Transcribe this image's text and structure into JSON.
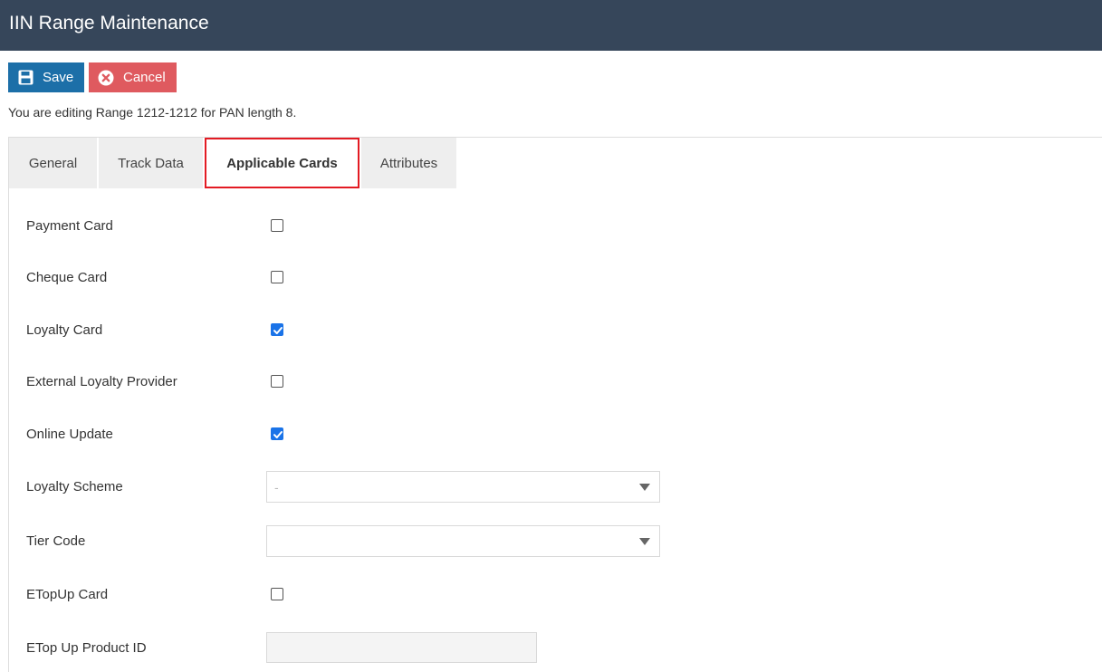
{
  "header": {
    "title": "IIN Range Maintenance"
  },
  "toolbar": {
    "save_label": "Save",
    "cancel_label": "Cancel",
    "save_icon": "floppy-disk-icon",
    "cancel_icon": "close-circle-icon"
  },
  "editing_message": "You are editing Range 1212-1212 for PAN length 8.",
  "tabs": [
    {
      "label": "General",
      "active": false
    },
    {
      "label": "Track Data",
      "active": false
    },
    {
      "label": "Applicable Cards",
      "active": true
    },
    {
      "label": "Attributes",
      "active": false
    }
  ],
  "form": {
    "payment_card": {
      "label": "Payment Card",
      "checked": false
    },
    "cheque_card": {
      "label": "Cheque Card",
      "checked": false
    },
    "loyalty_card": {
      "label": "Loyalty Card",
      "checked": true
    },
    "external_loyalty_provider": {
      "label": "External Loyalty Provider",
      "checked": false
    },
    "online_update": {
      "label": "Online Update",
      "checked": true
    },
    "loyalty_scheme": {
      "label": "Loyalty Scheme",
      "value": "-"
    },
    "tier_code": {
      "label": "Tier Code",
      "value": ""
    },
    "etopup_card": {
      "label": "ETopUp Card",
      "checked": false
    },
    "etop_up_product_id": {
      "label": "ETop Up Product ID",
      "value": ""
    }
  },
  "colors": {
    "header_bg": "#36465a",
    "save_bg": "#1c6fa8",
    "cancel_bg": "#df5a5f",
    "active_tab_highlight": "#e31b23",
    "checkbox_checked": "#1a73e8"
  }
}
